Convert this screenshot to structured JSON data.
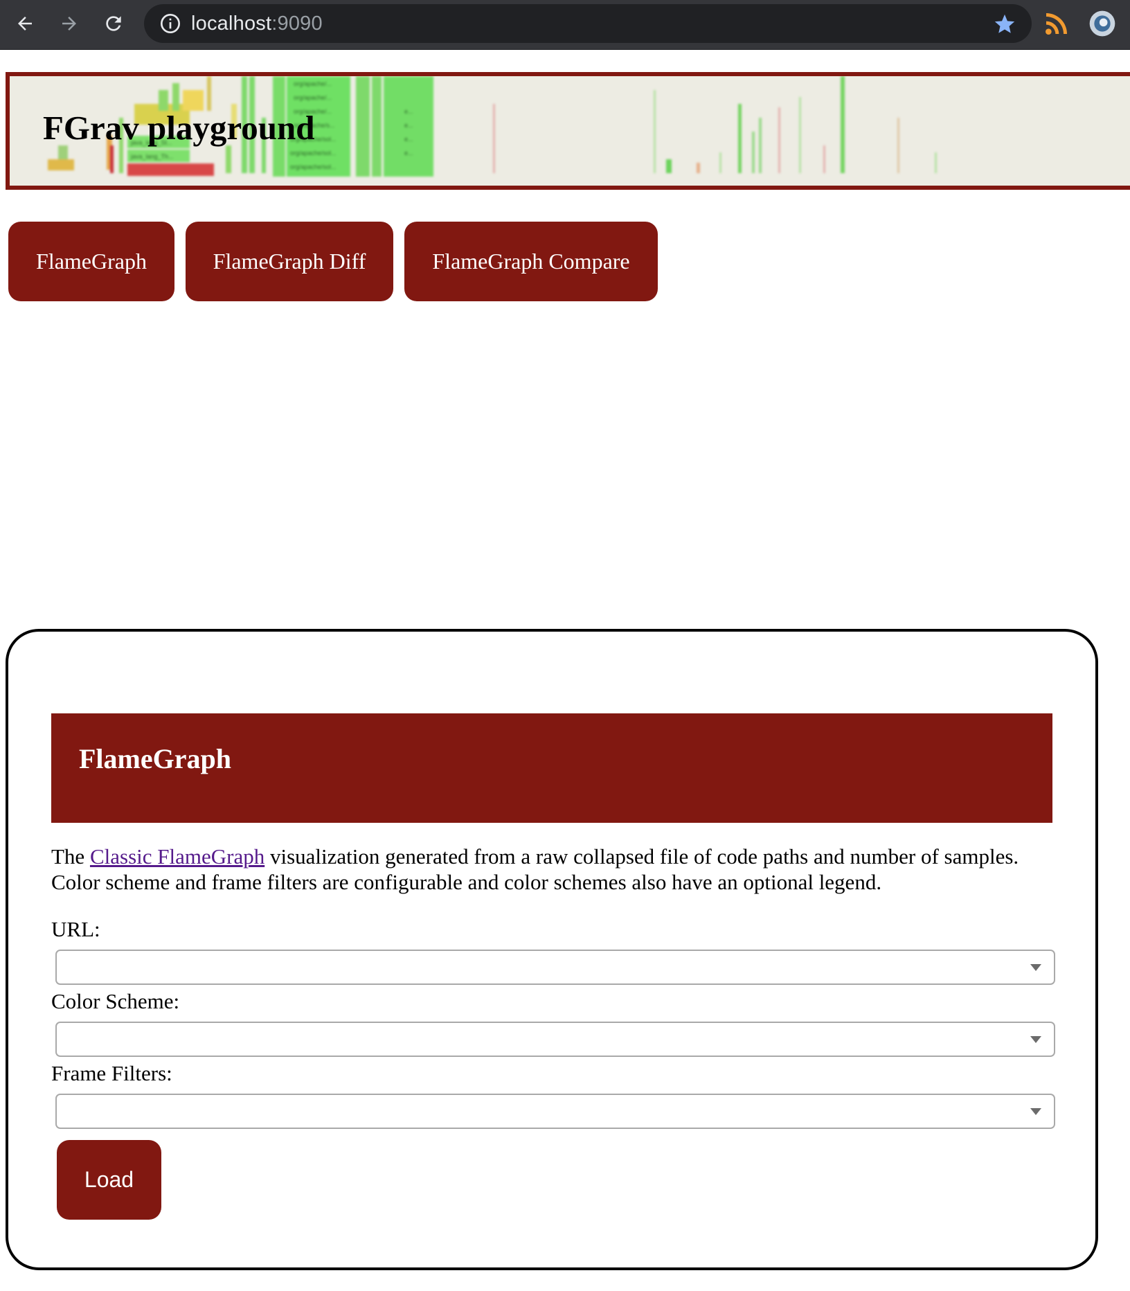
{
  "browser": {
    "url_host": "localhost",
    "url_port": ":9090"
  },
  "banner": {
    "title": "FGrav playground",
    "frame_labels": [
      "org/apache/...",
      "org/apache/...",
      "org/apache/...",
      "org/apache/s...",
      "org/apache/sol...",
      "org/apache/sol...",
      "org/apache/sol...",
      "java_lang_St...",
      "java_lang_Th...",
      "e...",
      "e...",
      "e...",
      "e..."
    ]
  },
  "nav": {
    "buttons": [
      "FlameGraph",
      "FlameGraph Diff",
      "FlameGraph Compare"
    ]
  },
  "card": {
    "title": "FlameGraph",
    "desc_prefix": "The ",
    "desc_link": "Classic FlameGraph",
    "desc_line1_rest": " visualization generated from a raw collapsed file of code paths and number of samples.",
    "desc_line2": "Color scheme and frame filters are configurable and color schemes also have an optional legend.",
    "fields": {
      "url_label": "URL:",
      "url_value": "",
      "color_label": "Color Scheme:",
      "color_value": "",
      "filters_label": "Frame Filters:",
      "filters_value": ""
    },
    "load_label": "Load"
  },
  "colors": {
    "brand": "#811811",
    "banner_bg": "#edece3",
    "link": "#551a8b"
  }
}
